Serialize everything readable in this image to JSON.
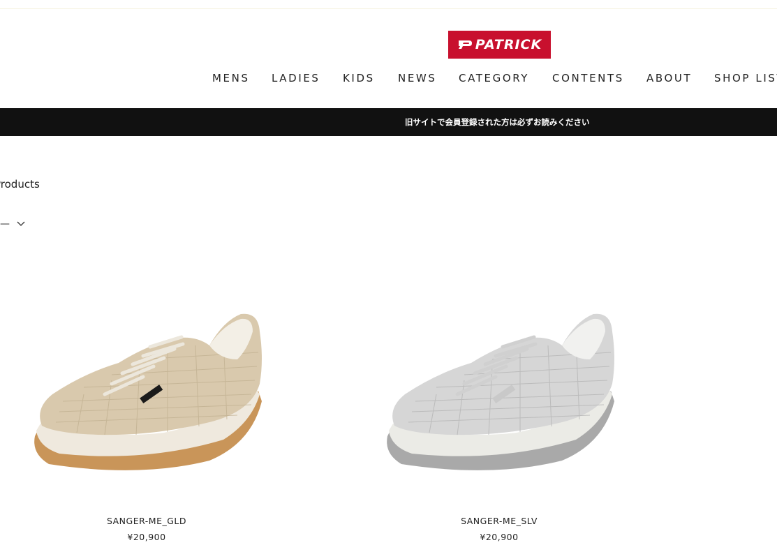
{
  "header": {
    "brand": "PATRICK",
    "nav": [
      "MENS",
      "LADIES",
      "KIDS",
      "NEWS",
      "CATEGORY",
      "CONTENTS",
      "ABOUT",
      "SHOP LIST"
    ]
  },
  "notice": {
    "text": "旧サイトで会員登録された方は必ずお読みください"
  },
  "page": {
    "heading": "Products",
    "sort_label": "—"
  },
  "products": [
    {
      "name": "SANGER-ME_GLD",
      "price": "¥20,900",
      "color": "gold"
    },
    {
      "name": "SANGER-ME_SLV",
      "price": "¥20,900",
      "color": "silver"
    }
  ],
  "icons": {
    "logo_mark": "patrick-p-icon",
    "sort": "chevron-down-icon"
  },
  "colors": {
    "brand_red": "#c8102e",
    "notice_bg": "#111111",
    "gold_upper": "#d9c9ad",
    "silver_upper": "#d6d6d6"
  }
}
